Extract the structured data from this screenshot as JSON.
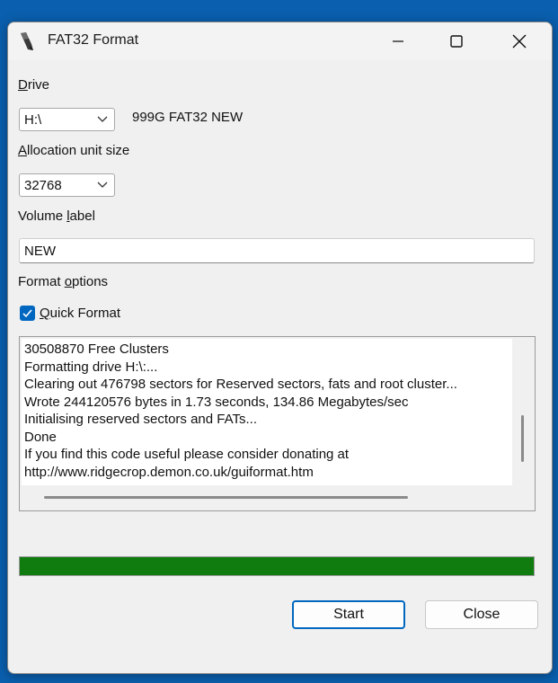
{
  "window": {
    "title": "FAT32 Format",
    "controls": [
      "minimize-icon",
      "maximize-icon",
      "close-icon"
    ]
  },
  "drive": {
    "label_accel": "D",
    "label_rest": "rive",
    "selected": "H:\\",
    "info": "999G FAT32 NEW"
  },
  "allocation": {
    "label_accel": "A",
    "label_rest": "llocation unit size",
    "selected": "32768"
  },
  "volume": {
    "label_pre": "Volume ",
    "label_accel": "l",
    "label_post": "abel",
    "value": "NEW"
  },
  "format_options": {
    "label_pre": "Format ",
    "label_accel": "o",
    "label_post": "ptions"
  },
  "quick_format": {
    "label_accel": "Q",
    "label_rest": "uick Format",
    "checked": true
  },
  "log": {
    "lines": [
      "30508870 Free Clusters",
      "Formatting drive H:\\:...",
      "Clearing out 476798 sectors for Reserved sectors, fats and root cluster...",
      "Wrote 244120576 bytes in 1.73 seconds, 134.86 Megabytes/sec",
      "Initialising reserved sectors and FATs...",
      "Done",
      "If you find this code useful please consider donating at",
      "http://www.ridgecrop.demon.co.uk/guiformat.htm"
    ]
  },
  "progress": {
    "percent": 100,
    "color": "#107c10"
  },
  "buttons": {
    "start": "Start",
    "close": "Close"
  },
  "colors": {
    "accent": "#0067c0",
    "desktop": "#0a5fae"
  }
}
